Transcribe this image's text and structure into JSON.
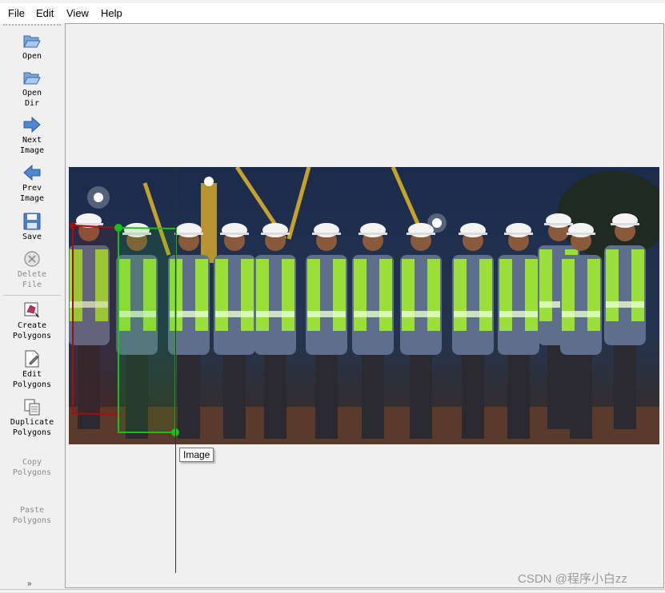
{
  "menu": {
    "file": "File",
    "edit": "Edit",
    "view": "View",
    "help": "Help"
  },
  "toolbar": {
    "open": "Open",
    "open_dir": "Open\nDir",
    "next_image": "Next\nImage",
    "prev_image": "Prev\nImage",
    "save": "Save",
    "delete_file": "Delete\nFile",
    "create_polygons": "Create\nPolygons",
    "edit_polygons": "Edit\nPolygons",
    "duplicate_polygons": "Duplicate\nPolygons",
    "copy_polygons": "Copy\nPolygons",
    "paste_polygons": "Paste\nPolygons",
    "more_glyph": "»"
  },
  "canvas": {
    "tooltip": "Image",
    "annotations": [
      {
        "color": "#a01010",
        "state": "completed"
      },
      {
        "color": "#18c018",
        "state": "selected"
      }
    ]
  },
  "watermark": "CSDN @程序小白zz",
  "colors": {
    "photo_sky": "#142038",
    "vest": "#9be03a",
    "helmet": "#f4f4f4",
    "red_polygon": "#a01010",
    "green_polygon": "#18c018"
  }
}
